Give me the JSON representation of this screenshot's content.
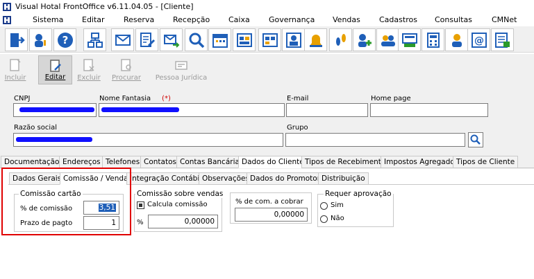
{
  "window": {
    "title": "Visual Hotal FrontOffice v6.11.04.05 - [Cliente]"
  },
  "menu": [
    "Sistema",
    "Editar",
    "Reserva",
    "Recepção",
    "Caixa",
    "Governança",
    "Vendas",
    "Cadastros",
    "Consultas",
    "CMNet"
  ],
  "commands": {
    "incluir": "Incluir",
    "editar": "Editar",
    "excluir": "Excluir",
    "procurar": "Procurar",
    "pessoa_juridica": "Pessoa Jurídica"
  },
  "form": {
    "cnpj_label": "CNPJ",
    "nome_fantasia_label": "Nome Fantasia",
    "required_mark": "(*)",
    "email_label": "E-mail",
    "homepage_label": "Home page",
    "razao_social_label": "Razão social",
    "grupo_label": "Grupo"
  },
  "main_tabs": [
    "Documentação",
    "Endereços",
    "Telefones",
    "Contatos",
    "Contas Bancárias",
    "Dados do Cliente",
    "Tipos de Recebimento",
    "Impostos Agregados",
    "Tipos de Cliente"
  ],
  "sub_tabs": [
    "Dados Gerais",
    "Comissão / Vendas",
    "Integração Contábil",
    "Observações",
    "Dados do Promotor",
    "Distribuição"
  ],
  "comissao_cartao": {
    "title": "Comissão cartão",
    "pct_label": "% de comissão",
    "pct_value": "3,51",
    "prazo_label": "Prazo de pagto",
    "prazo_value": "1"
  },
  "comissao_vendas": {
    "title": "Comissão sobre vendas",
    "calcula_label": "Calcula comissão",
    "pct_symbol": "%",
    "value": "0,00000"
  },
  "com_cobrar": {
    "label": "% de com. a cobrar",
    "value": "0,00000"
  },
  "aprovacao": {
    "title": "Requer aprovação",
    "sim": "Sim",
    "nao": "Não"
  },
  "colors": {
    "highlight": "#e00000",
    "redaction": "#1010ff"
  }
}
